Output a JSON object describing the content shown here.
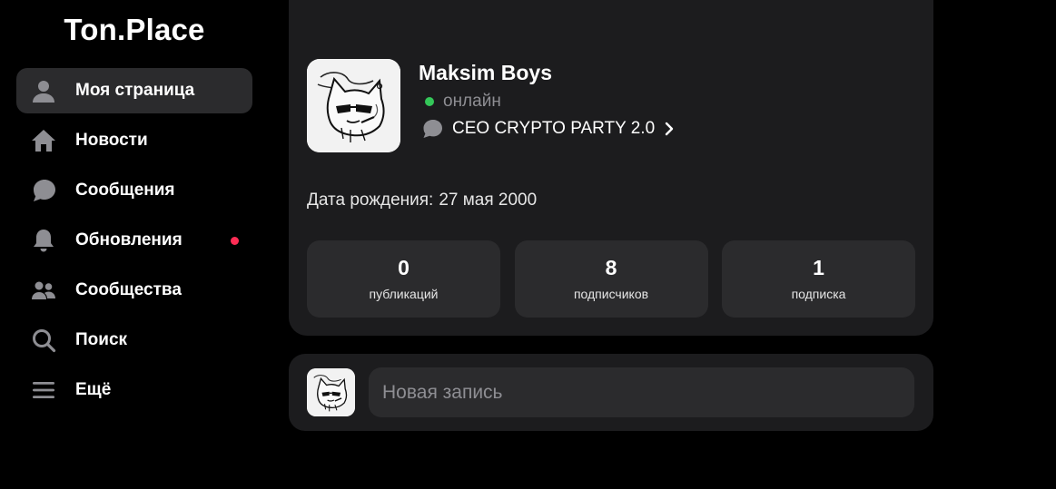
{
  "app": {
    "logo": "Ton.Place"
  },
  "sidebar": {
    "items": [
      {
        "label": "Моя страница",
        "icon": "person-icon",
        "active": true
      },
      {
        "label": "Новости",
        "icon": "home-icon"
      },
      {
        "label": "Сообщения",
        "icon": "chat-bubble-icon"
      },
      {
        "label": "Обновления",
        "icon": "bell-icon",
        "badge_dot": true
      },
      {
        "label": "Сообщества",
        "icon": "people-icon"
      },
      {
        "label": "Поиск",
        "icon": "search-icon"
      },
      {
        "label": "Ещё",
        "icon": "menu-icon"
      }
    ]
  },
  "profile": {
    "name": "Maksim Boys",
    "status": "онлайн",
    "bio": "CEO CRYPTO PARTY 2.0",
    "birth_label": "Дата рождения:",
    "birth_value": "27 мая 2000",
    "stats": [
      {
        "value": "0",
        "label": "публикаций"
      },
      {
        "value": "8",
        "label": "подписчиков"
      },
      {
        "value": "1",
        "label": "подписка"
      }
    ]
  },
  "composer": {
    "placeholder": "Новая запись"
  },
  "colors": {
    "background": "#000000",
    "card": "#1c1c1e",
    "tile": "#2b2b2d",
    "online": "#34c759",
    "badge": "#ff2d55",
    "muted": "#8e8e93"
  }
}
